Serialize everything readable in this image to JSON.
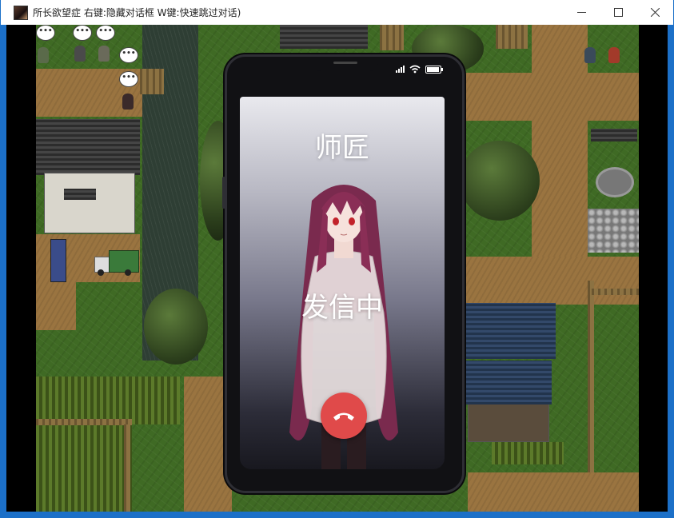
{
  "window": {
    "title": "所长欲望症 右键:隐藏对话框 W键:快速跳过对话)",
    "minimize_glyph": "—",
    "maximize_glyph": "☐",
    "close_glyph": "✕"
  },
  "map": {
    "speech_bubble_text": "•••"
  },
  "phone": {
    "caller_name": "师匠",
    "call_status": "发信中",
    "end_call_color": "#e04a4a"
  }
}
